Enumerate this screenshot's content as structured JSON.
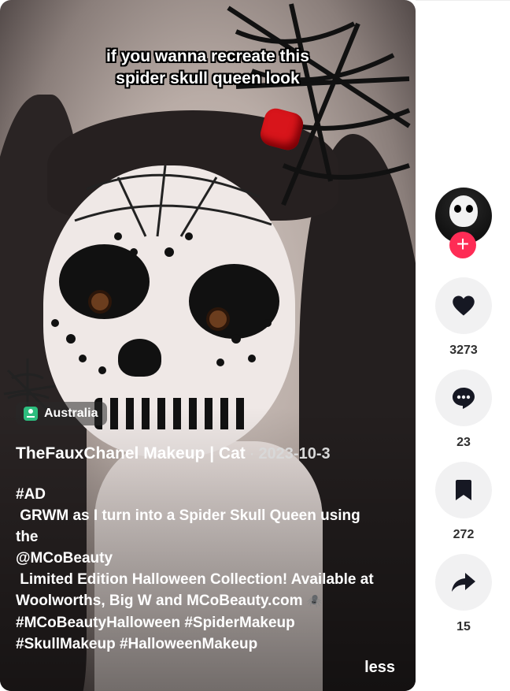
{
  "video": {
    "caption_lines": [
      "if you wanna recreate this",
      "spider skull queen look"
    ],
    "location": "Australia",
    "author": "TheFauxChanel Makeup | Cat",
    "separator": "·",
    "date": "2023-10-3",
    "description_lines": [
      "#AD",
      " GRWM as I turn into a Spider Skull Queen using",
      "the",
      "@MCoBeauty",
      " Limited Edition Halloween Collection! Available at",
      "Woolworths, Big W and MCoBeauty.com",
      "#MCoBeautyHalloween #SpiderMakeup",
      "#SkullMakeup #HalloweenMakeup"
    ],
    "description_emoji": "🕷️",
    "less_label": "less"
  },
  "actions": {
    "follow_icon": "+",
    "like_count": "3273",
    "comment_count": "23",
    "save_count": "272",
    "share_count": "15"
  },
  "colors": {
    "follow": "#fe2c55",
    "action_bg": "#f1f1f2",
    "location_icon": "#2dbd7e"
  }
}
